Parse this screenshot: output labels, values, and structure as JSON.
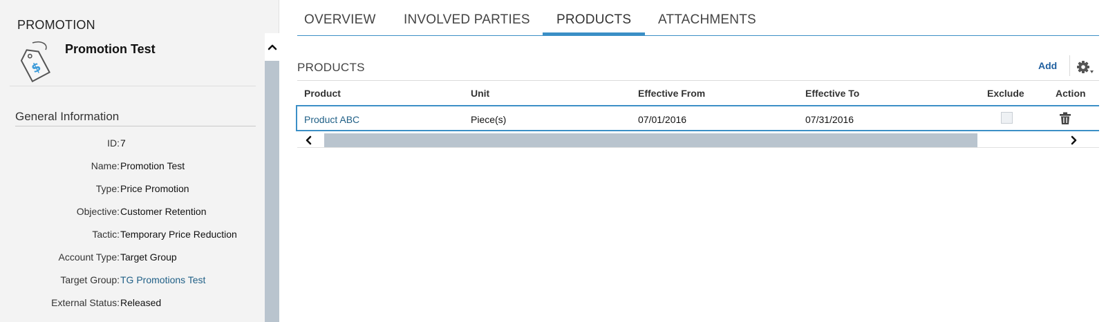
{
  "left_panel": {
    "object_type": "PROMOTION",
    "object_name": "Promotion Test",
    "icon": "price-tag-icon",
    "section_title": "General Information",
    "fields": [
      {
        "label": "ID:",
        "value": "7"
      },
      {
        "label": "Name:",
        "value": "Promotion Test"
      },
      {
        "label": "Type:",
        "value": "Price Promotion"
      },
      {
        "label": "Objective:",
        "value": "Customer Retention"
      },
      {
        "label": "Tactic:",
        "value": "Temporary Price Reduction"
      },
      {
        "label": "Account Type:",
        "value": "Target Group"
      },
      {
        "label": "Target Group:",
        "value": "TG Promotions Test"
      },
      {
        "label": "External Status:",
        "value": "Released"
      }
    ]
  },
  "tabs": [
    {
      "label": "OVERVIEW",
      "active": false
    },
    {
      "label": "INVOLVED PARTIES",
      "active": false
    },
    {
      "label": "PRODUCTS",
      "active": true
    },
    {
      "label": "ATTACHMENTS",
      "active": false
    }
  ],
  "products": {
    "title": "PRODUCTS",
    "add_label": "Add",
    "settings_icon": "gear-icon",
    "columns": [
      "Product",
      "Unit",
      "Effective From",
      "Effective To",
      "Exclude",
      "Action"
    ],
    "rows": [
      {
        "product": "Product ABC",
        "unit": "Piece(s)",
        "effective_from": "07/01/2016",
        "effective_to": "07/31/2016",
        "exclude": false,
        "action_icon": "trash-icon"
      }
    ]
  },
  "colors": {
    "accent": "#3b8fc6",
    "link": "#1f5f86",
    "scrollbar": "#b9c4ce",
    "panel_bg": "#f3f3f3"
  }
}
